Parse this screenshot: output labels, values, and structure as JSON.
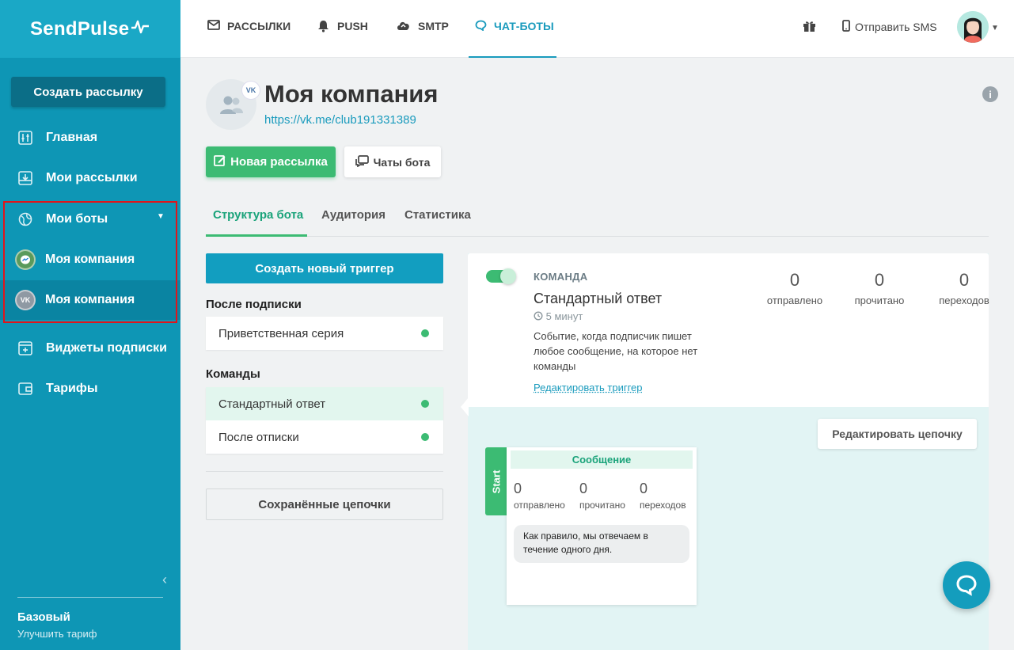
{
  "brand": {
    "logo_text": "SendPulse"
  },
  "sidebar": {
    "create_button": "Создать рассылку",
    "items": [
      {
        "label": "Главная",
        "icon": "sliders-icon"
      },
      {
        "label": "Мои рассылки",
        "icon": "inbox-icon"
      },
      {
        "label": "Мои боты",
        "icon": "globe-icon"
      },
      {
        "label": "Моя компания",
        "icon": "messenger-icon"
      },
      {
        "label": "Моя компания",
        "icon": "vk-icon"
      },
      {
        "label": "Виджеты подписки",
        "icon": "widget-icon"
      },
      {
        "label": "Тарифы",
        "icon": "wallet-icon"
      }
    ],
    "plan": {
      "name": "Базовый",
      "upgrade": "Улучшить тариф"
    }
  },
  "topbar": {
    "tabs": [
      {
        "label": "РАССЫЛКИ",
        "icon": "mail-icon"
      },
      {
        "label": "PUSH",
        "icon": "bell-icon"
      },
      {
        "label": "SMTP",
        "icon": "cloud-icon"
      },
      {
        "label": "ЧАТ-БОТЫ",
        "icon": "chat-icon"
      }
    ],
    "send_sms": "Отправить SMS"
  },
  "page": {
    "title": "Моя компания",
    "link": "https://vk.me/club191331389",
    "badge": "VK",
    "new_mailing_button": "Новая рассылка",
    "bot_chats_button": "Чаты бота",
    "tabs": [
      "Структура бота",
      "Аудитория",
      "Статистика"
    ]
  },
  "left": {
    "create_trigger": "Создать новый триггер",
    "after_subscribe_label": "После подписки",
    "welcome_series": "Приветственная серия",
    "commands_label": "Команды",
    "commands": [
      "Стандартный ответ",
      "После отписки"
    ],
    "saved_chains": "Сохранённые цепочки"
  },
  "trigger": {
    "type_label": "КОМАНДА",
    "title": "Стандартный ответ",
    "time": "5 минут",
    "description": "Событие, когда подписчик пишет любое сообщение, на которое нет команды",
    "edit_link": "Редактировать триггер",
    "stats": [
      {
        "value": "0",
        "label": "отправлено"
      },
      {
        "value": "0",
        "label": "прочитано"
      },
      {
        "value": "0",
        "label": "переходов"
      }
    ],
    "enabled": true
  },
  "chain": {
    "edit_button": "Редактировать цепочку",
    "start_label": "Start",
    "message_header": "Сообщение",
    "stats": [
      {
        "value": "0",
        "label": "отправлено"
      },
      {
        "value": "0",
        "label": "прочитано"
      },
      {
        "value": "0",
        "label": "переходов"
      }
    ],
    "message_text": "Как правило, мы отвечаем в течение одного дня."
  },
  "colors": {
    "sidebar": "#0e96b5",
    "accent": "#1a9bbd",
    "green": "#3cbb73",
    "highlight": "#e0151b"
  }
}
